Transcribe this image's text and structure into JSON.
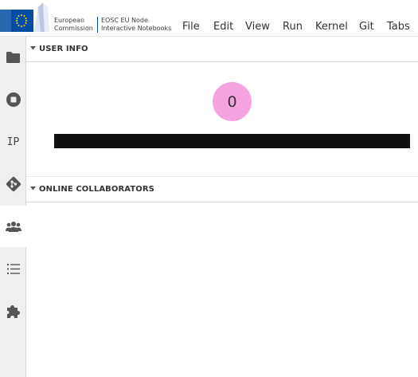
{
  "branding": {
    "org_line1": "European",
    "org_line2": "Commission",
    "node_line1": "EOSC EU Node",
    "node_line2": "Interactive Notebooks",
    "brand_blue": "#034ea2"
  },
  "menu": {
    "items": [
      "File",
      "Edit",
      "View",
      "Run",
      "Kernel",
      "Git",
      "Tabs"
    ]
  },
  "sidebar": {
    "items": [
      {
        "name": "folder-icon"
      },
      {
        "name": "stop-circle-icon"
      },
      {
        "name": "ip-label",
        "label": "IP"
      },
      {
        "name": "git-icon"
      },
      {
        "name": "users-icon"
      },
      {
        "name": "list-icon"
      },
      {
        "name": "puzzle-icon"
      }
    ],
    "active_index": 4
  },
  "panel": {
    "user_info_title": "USER INFO",
    "avatar_initial": "0",
    "avatar_color": "#f4a3df",
    "collaborators_title": "ONLINE COLLABORATORS"
  }
}
